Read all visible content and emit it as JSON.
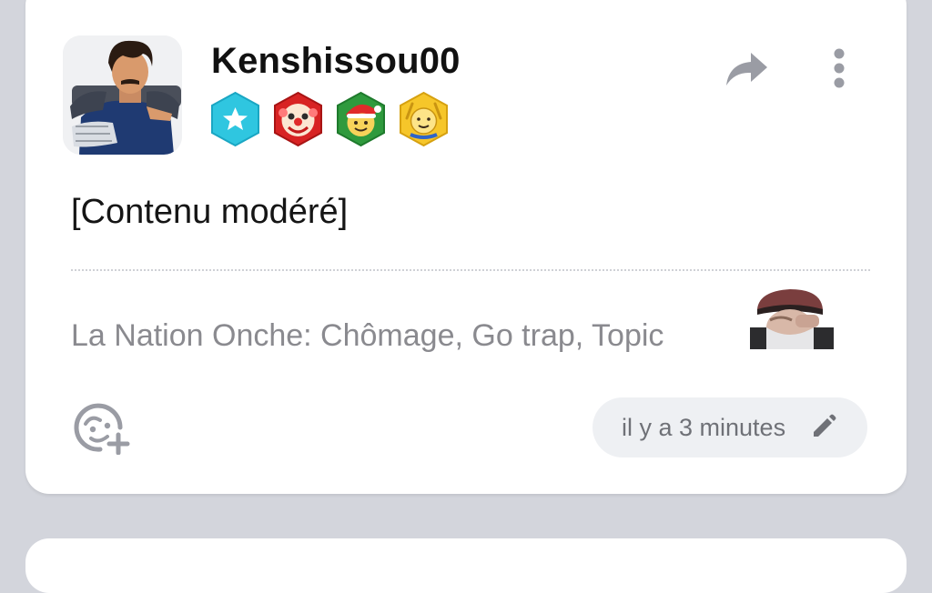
{
  "post": {
    "author": "Kenshissou00",
    "badges": [
      "star-badge-icon",
      "clown-badge-icon",
      "santa-badge-icon",
      "cheer-badge-icon"
    ],
    "content": "[Contenu modéré]",
    "signature": "La Nation Onche: Chômage, Go trap, Topic",
    "timestamp": "il y a 3 minutes"
  },
  "colors": {
    "background": "#d3d5dc",
    "card": "#ffffff",
    "muted_text": "#8a8a8f",
    "icon": "#9a9ca4",
    "pill": "#eef0f3"
  }
}
